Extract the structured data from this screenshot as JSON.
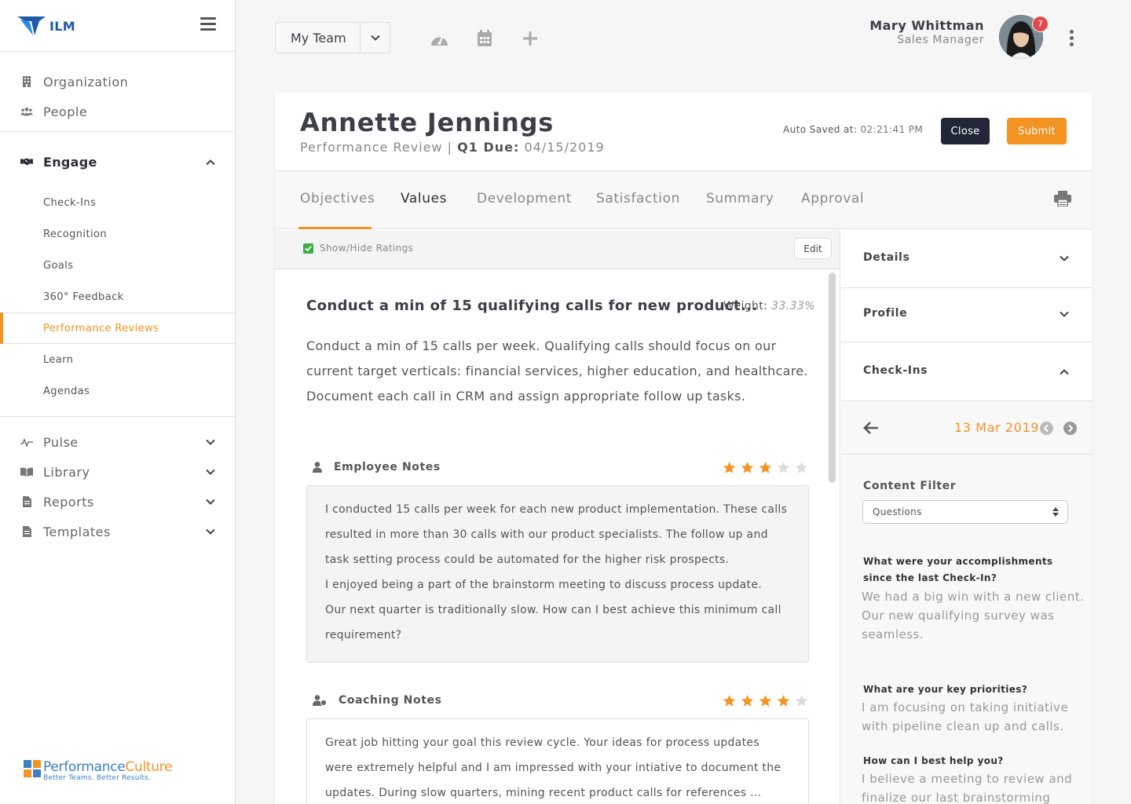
{
  "app": {
    "logo_text": "ILM"
  },
  "sidebar": {
    "top_items": [
      {
        "label": "Organization",
        "icon": "building-icon"
      },
      {
        "label": "People",
        "icon": "people-icon"
      }
    ],
    "engage": {
      "label": "Engage",
      "icon": "handshake-icon",
      "expanded": true
    },
    "sub_items": [
      {
        "label": "Check-Ins"
      },
      {
        "label": "Recognition"
      },
      {
        "label": "Goals"
      },
      {
        "label": "360° Feedback"
      },
      {
        "label": "Performance Reviews",
        "active": true
      },
      {
        "label": "Learn"
      },
      {
        "label": "Agendas"
      }
    ],
    "bottom_items": [
      {
        "label": "Pulse",
        "icon": "pulse-icon"
      },
      {
        "label": "Library",
        "icon": "book-icon"
      },
      {
        "label": "Reports",
        "icon": "file-icon"
      },
      {
        "label": "Templates",
        "icon": "file-icon"
      }
    ],
    "footer_logo": {
      "part1": "Performance",
      "part2": "Culture",
      "tagline": "Better Teams. Better Results."
    }
  },
  "topbar": {
    "team_select": "My Team",
    "icons": [
      "dashboard-icon",
      "calendar-icon",
      "plus-icon"
    ],
    "user": {
      "name": "Mary Whittman",
      "role": "Sales Manager",
      "notifications": "7"
    }
  },
  "review": {
    "employee_name": "Annette Jennings",
    "review_type": "Performance Review",
    "separator": "|",
    "quarter_label": "Q1 Due:",
    "due_date": "04/15/2019",
    "autosave_label": "Auto Saved at:",
    "autosave_time": "02:21:41 PM",
    "close_label": "Close",
    "submit_label": "Submit"
  },
  "tabs": [
    {
      "label": "Objectives",
      "active": true
    },
    {
      "label": "Values"
    },
    {
      "label": "Development"
    },
    {
      "label": "Satisfaction"
    },
    {
      "label": "Summary"
    },
    {
      "label": "Approval"
    }
  ],
  "ratings_bar": {
    "toggle_label": "Show/Hide Ratings",
    "checked": true,
    "edit_label": "Edit"
  },
  "objective": {
    "title": "Conduct a min of 15 qualifying calls for new product...",
    "weight_label": "Weight:",
    "weight_value": "33.33%",
    "description": "Conduct a min of 15 calls per week. Qualifying calls should focus on our current target verticals: financial services, higher education, and healthcare. Document each call in CRM and assign appropriate follow up tasks."
  },
  "employee_notes": {
    "label": "Employee Notes",
    "rating": 3,
    "rating_max": 5,
    "lines": [
      "I conducted 15 calls per week for each new product implementation.  These calls resulted in more than 30 calls with our product specialists.  The follow up and task setting process could be automated for the higher risk prospects.",
      "I enjoyed being a part of the brainstorm meeting to discuss process update.",
      "Our next quarter is traditionally slow.  How can I best achieve this minimum call requirement?"
    ]
  },
  "coaching_notes": {
    "label": "Coaching Notes",
    "rating": 4,
    "rating_max": 5,
    "text": "Great job hitting your goal this review cycle.  Your ideas for process updates were extremely helpful and I am impressed with your intiative to document the updates.  During slow quarters, mining recent product calls for references ..."
  },
  "right_panel": {
    "sections": [
      {
        "label": "Details",
        "expanded": false
      },
      {
        "label": "Profile",
        "expanded": false
      },
      {
        "label": "Check-Ins",
        "expanded": true
      }
    ],
    "date": "13 Mar 2019",
    "content_filter_label": "Content Filter",
    "content_filter_value": "Questions",
    "qa": [
      {
        "q": "What were your accomplishments since the last Check-In?",
        "a": "We had a big win with a new client. Our new qualifying survey was seamless."
      },
      {
        "q": "What are your key priorities?",
        "a": "I am focusing on taking initiative with pipeline clean up and calls."
      },
      {
        "q": "How can I best help you?",
        "a": "I believe a meeting to review and finalize our last brainstorming"
      }
    ]
  },
  "colors": {
    "accent": "#f39322",
    "dark": "#222738",
    "check": "#3fae49",
    "badge": "#e04a4a"
  }
}
